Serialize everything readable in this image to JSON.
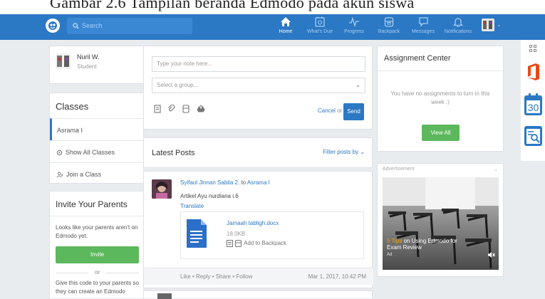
{
  "caption_text": "Gambar 2.6 Tampilan beranda Edmodo pada akun siswa",
  "colors": {
    "brand": "#2b78c4",
    "nav_inactive": "#a9cdf0",
    "button_green": "#5cb85c",
    "office_red": "#e64a19"
  },
  "nav": {
    "search_placeholder": "Search",
    "items": [
      {
        "label": "Home",
        "icon": "home-icon",
        "active": true
      },
      {
        "label": "What's Due",
        "icon": "calendar-icon"
      },
      {
        "label": "Progress",
        "icon": "progress-icon"
      },
      {
        "label": "Backpack",
        "icon": "backpack-icon"
      },
      {
        "label": "Messages",
        "icon": "message-icon"
      },
      {
        "label": "Notifications",
        "icon": "bell-icon"
      }
    ]
  },
  "profile": {
    "name": "Nuril W.",
    "role": "Student"
  },
  "classes": {
    "title": "Classes",
    "items": [
      {
        "label": "Asrama I"
      }
    ],
    "show_all": "Show All Classes",
    "join": "Join a Class"
  },
  "invite": {
    "title": "Invite Your Parents",
    "text": "Looks like your parents aren't on Edmodo yet.",
    "button": "Invite",
    "or": "or",
    "code_text": "Give this code to your parents so they can create an Edmodo"
  },
  "composer": {
    "note_placeholder": "Type your note here...",
    "group_placeholder": "Select a group...",
    "cancel": "Cancel",
    "or": "or",
    "send": "Send"
  },
  "latest_posts": {
    "title": "Latest Posts",
    "filter": "Filter posts by",
    "post": {
      "author": "Syifaul Jinnan Sabila 2.",
      "to": "to",
      "group": "Asrama I",
      "text": "Artikel Ayu nurdiana i.6",
      "translate": "Translate",
      "attachment": {
        "name": "Jamaah tabligh.docx",
        "size": "18.0KB",
        "action": "Add to Backpack"
      },
      "actions": {
        "like": "Like",
        "reply": "Reply",
        "share": "Share",
        "follow": "Follow",
        "sep": "•"
      },
      "date": "Mar 1, 2017, 10:42 PM"
    }
  },
  "assignment_center": {
    "title": "Assignment Center",
    "empty": "You have no assignments to turn in this week :)",
    "button": "View All"
  },
  "advertisement": {
    "label": "Advertisement",
    "caption_highlight": "5 Tips",
    "caption_rest": "on Using Edmodo for Exam Review",
    "tag": "Ad"
  }
}
